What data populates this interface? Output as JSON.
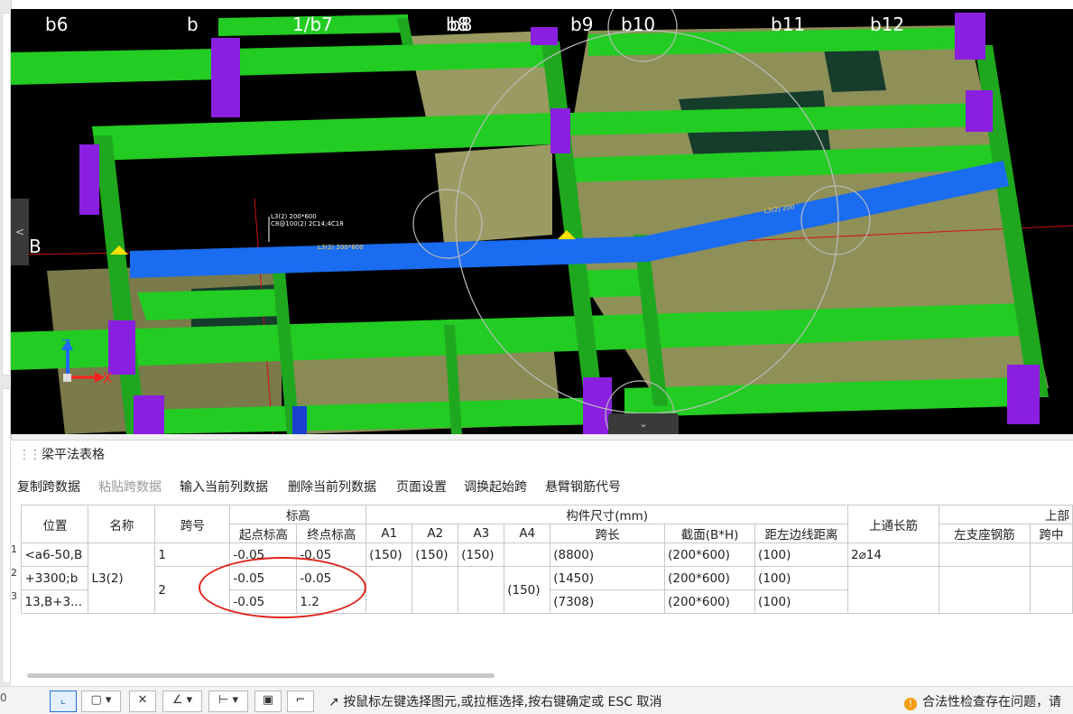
{
  "viewport": {
    "axis_labels": [
      "b6",
      "b",
      "1/b7",
      "b8",
      "b8",
      "b9",
      "b10",
      "b11",
      "b12",
      "B"
    ],
    "coord_z": "Z",
    "coord_x": "X",
    "side_tab_glyph": "<",
    "bottom_tab_glyph": "⌄",
    "beam_text_1": "L3(2) 200*600",
    "beam_text_2": "C8@100(2) 2C14;4C18",
    "beam_span_label_1": "L3(2) 200*600",
    "beam_span_label_2": "L3(2) 200"
  },
  "panel": {
    "title": "梁平法表格",
    "toolbar": {
      "copy_span": "复制跨数据",
      "paste_span": "粘贴跨数据",
      "input_column": "输入当前列数据",
      "delete_column": "删除当前列数据",
      "page_setup": "页面设置",
      "swap_start": "调换起始跨",
      "cantilever_code": "悬臂钢筋代号"
    },
    "headers": {
      "position": "位置",
      "name": "名称",
      "span_no": "跨号",
      "elevation": "标高",
      "start_elev": "起点标高",
      "end_elev": "终点标高",
      "size_group": "构件尺寸(mm)",
      "a1": "A1",
      "a2": "A2",
      "a3": "A3",
      "a4": "A4",
      "span_length": "跨长",
      "section": "截面(B*H)",
      "left_edge_dist": "距左边线距离",
      "top_through": "上通长筋",
      "top_part": "上部",
      "left_support": "左支座钢筋",
      "span_mid": "跨中"
    },
    "row_numbers": [
      "1",
      "2",
      "3"
    ],
    "position_lines": [
      "<a6-50,B",
      "+3300;b",
      "13,B+3..."
    ],
    "name": "L3(2)",
    "rows": [
      {
        "span": "1",
        "start": "-0.05",
        "end": "-0.05",
        "a1": "(150)",
        "a2": "(150)",
        "a3": "(150)",
        "a4": "",
        "length": "(8800)",
        "section": "(200*600)",
        "dist": "(100)",
        "top": "2⌀14"
      },
      {
        "span": "2",
        "start": "-0.05",
        "end": "-0.05",
        "a1": "",
        "a2": "",
        "a3": "",
        "a4": "(150)",
        "length": "(1450)",
        "section": "(200*600)",
        "dist": "(100)",
        "top": ""
      },
      {
        "span": "",
        "start": "-0.05",
        "end": "1.2",
        "a1": "",
        "a2": "",
        "a3": "",
        "a4": "",
        "length": "(7308)",
        "section": "(200*600)",
        "dist": "(100)",
        "top": ""
      }
    ]
  },
  "status": {
    "hint": "按鼠标左键选择图元,或拉框选择,按右键确定或 ESC 取消",
    "warning": "合法性检查存在问题，请",
    "corner": "0"
  },
  "colors": {
    "beam_green": "#22cc22",
    "beam_blue": "#1a6cf0",
    "column_purple": "#8a1fe0",
    "slab_olive": "#9a9a62",
    "highlight_red": "#e0231c"
  }
}
